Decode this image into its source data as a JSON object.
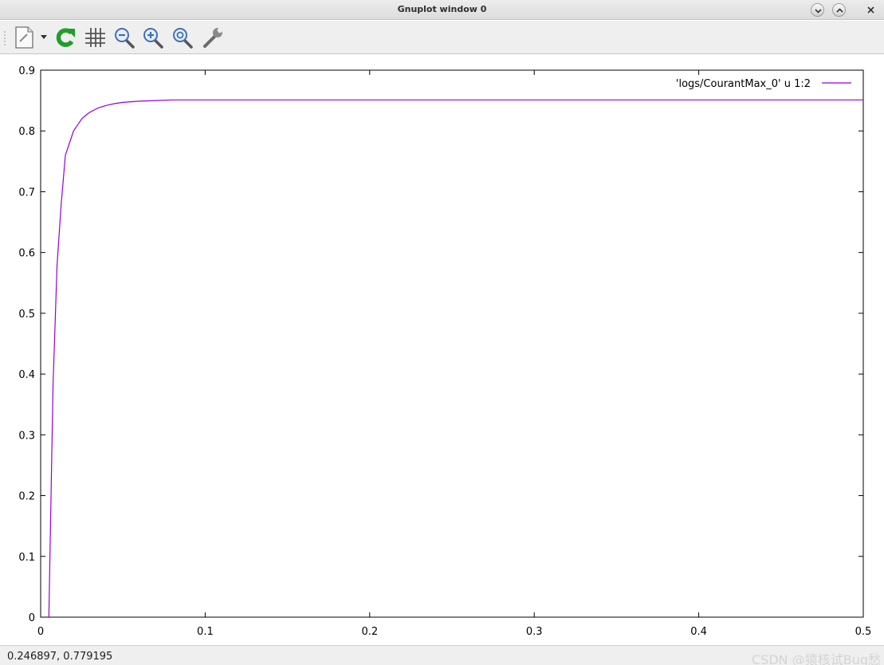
{
  "window": {
    "title": "Gnuplot window 0",
    "controls": [
      "minimize-icon",
      "maximize-icon",
      "close-icon"
    ]
  },
  "toolbar": {
    "buttons": [
      {
        "name": "export-button",
        "icon": "export-document-icon",
        "has_dropdown": true
      },
      {
        "name": "replot-button",
        "icon": "refresh-icon"
      },
      {
        "name": "grid-button",
        "icon": "grid-icon"
      },
      {
        "name": "zoom-previous-button",
        "icon": "zoom-out-icon"
      },
      {
        "name": "zoom-next-button",
        "icon": "zoom-in-icon"
      },
      {
        "name": "autoscale-button",
        "icon": "zoom-fit-icon"
      },
      {
        "name": "settings-button",
        "icon": "wrench-icon"
      }
    ]
  },
  "status": {
    "coordinates": "0.246897,  0.779195",
    "watermark": "CSDN @猿核试Bug愁"
  },
  "colors": {
    "series": "#9400d3",
    "toolbar_bg": "#efefef",
    "refresh_green": "#1e9e2a",
    "zoom_blue": "#3f6fb8"
  },
  "chart_data": {
    "type": "line",
    "title": "",
    "xlabel": "",
    "ylabel": "",
    "xlim": [
      0,
      0.5
    ],
    "ylim": [
      0,
      0.9
    ],
    "xticks": [
      0,
      0.1,
      0.2,
      0.3,
      0.4,
      0.5
    ],
    "yticks": [
      0,
      0.1,
      0.2,
      0.3,
      0.4,
      0.5,
      0.6,
      0.7,
      0.8,
      0.9
    ],
    "xtick_labels": [
      "0",
      "0.1",
      "0.2",
      "0.3",
      "0.4",
      "0.5"
    ],
    "ytick_labels": [
      "0",
      "0.1",
      "0.2",
      "0.3",
      "0.4",
      "0.5",
      "0.6",
      "0.7",
      "0.8",
      "0.9"
    ],
    "grid": false,
    "legend_position": "top-right",
    "series": [
      {
        "name": "'logs/CourantMax_0' u 1:2",
        "color": "#9400d3",
        "x": [
          0.005,
          0.0075,
          0.01,
          0.0125,
          0.015,
          0.0175,
          0.02,
          0.0225,
          0.025,
          0.0275,
          0.03,
          0.035,
          0.04,
          0.045,
          0.05,
          0.06,
          0.07,
          0.08,
          0.1,
          0.15,
          0.2,
          0.3,
          0.4,
          0.5
        ],
        "y": [
          0.0,
          0.38,
          0.58,
          0.68,
          0.76,
          0.78,
          0.8,
          0.81,
          0.82,
          0.826,
          0.831,
          0.838,
          0.842,
          0.845,
          0.847,
          0.849,
          0.85,
          0.851,
          0.851,
          0.851,
          0.851,
          0.851,
          0.851,
          0.851
        ]
      }
    ]
  }
}
